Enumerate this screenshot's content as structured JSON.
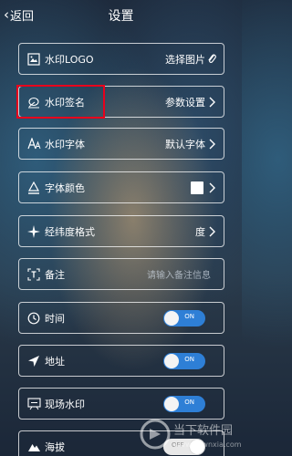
{
  "header": {
    "back_label": "返回",
    "title": "设置"
  },
  "rows": [
    {
      "name": "logo",
      "label": "水印LOGO",
      "value": "选择图片",
      "icon": "image-icon",
      "right": "paperclip-icon"
    },
    {
      "name": "signature",
      "label": "水印签名",
      "value": "参数设置",
      "icon": "signature-icon",
      "right": "chevron-right-icon"
    },
    {
      "name": "font",
      "label": "水印字体",
      "value": "默认字体",
      "icon": "font-icon",
      "right": "chevron-right-icon"
    },
    {
      "name": "font-color",
      "label": "字体颜色",
      "value": "",
      "icon": "font-color-icon",
      "right": "chevron-right-icon",
      "swatch_color": "#ffffff"
    },
    {
      "name": "coord-format",
      "label": "经纬度格式",
      "value": "度",
      "icon": "compass-icon",
      "right": "chevron-right-icon"
    },
    {
      "name": "note",
      "label": "备注",
      "placeholder": "请输入备注信息",
      "icon": "note-icon"
    },
    {
      "name": "time",
      "label": "时间",
      "toggle": "ON",
      "icon": "clock-icon"
    },
    {
      "name": "address",
      "label": "地址",
      "toggle": "ON",
      "icon": "location-arrow-icon"
    },
    {
      "name": "onsite-watermark",
      "label": "现场水印",
      "toggle": "ON",
      "icon": "onsite-icon"
    },
    {
      "name": "altitude",
      "label": "海拔",
      "toggle": "OFF",
      "icon": "mountain-icon"
    }
  ],
  "watermark": {
    "text": "当下软件园",
    "url": "www.downxia.com"
  },
  "colors": {
    "accent": "#2e7fd6",
    "highlight": "#e8001c"
  }
}
